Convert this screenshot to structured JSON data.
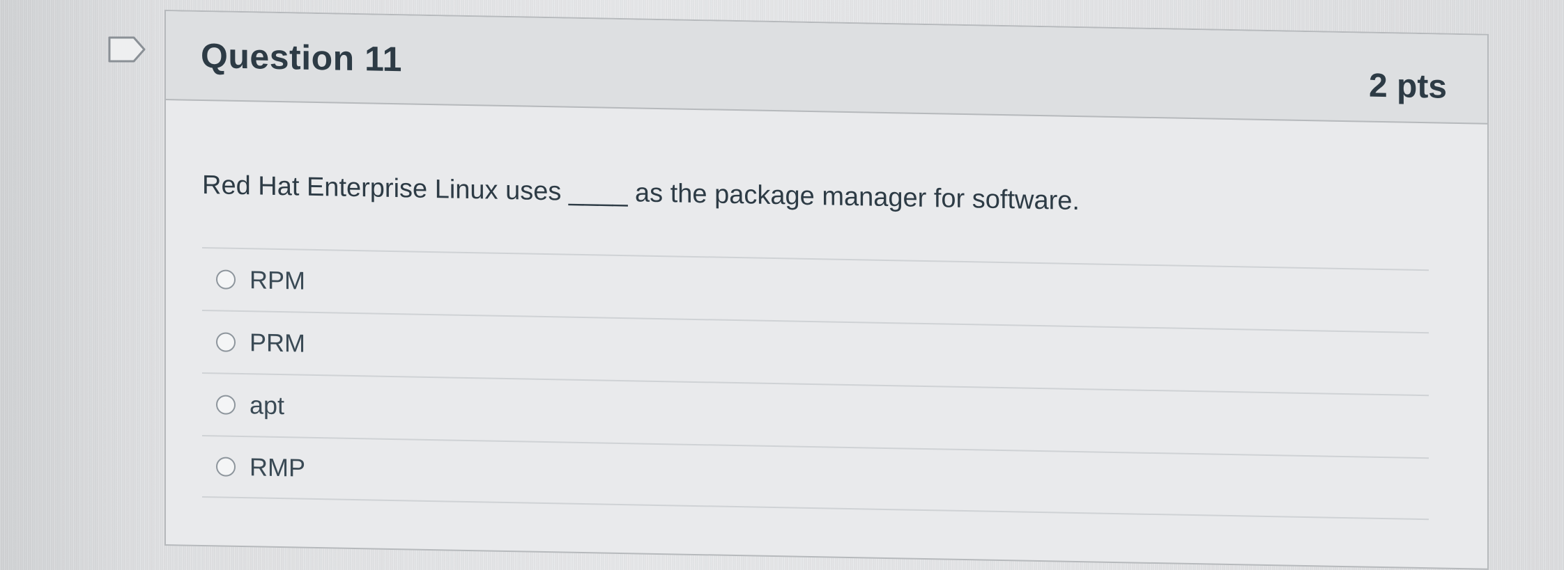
{
  "question": {
    "title": "Question 11",
    "points": "2 pts",
    "text": "Red Hat Enterprise Linux uses ____ as the package manager for software.",
    "flag_icon": "bookmark-flag-icon"
  },
  "answers": [
    {
      "label": "RPM",
      "selected": false
    },
    {
      "label": "PRM",
      "selected": false
    },
    {
      "label": "apt",
      "selected": false
    },
    {
      "label": "RMP",
      "selected": false
    }
  ],
  "colors": {
    "title_text": "#2d3b45",
    "border": "#b6b9bc",
    "header_bg": "#dddfe1"
  }
}
